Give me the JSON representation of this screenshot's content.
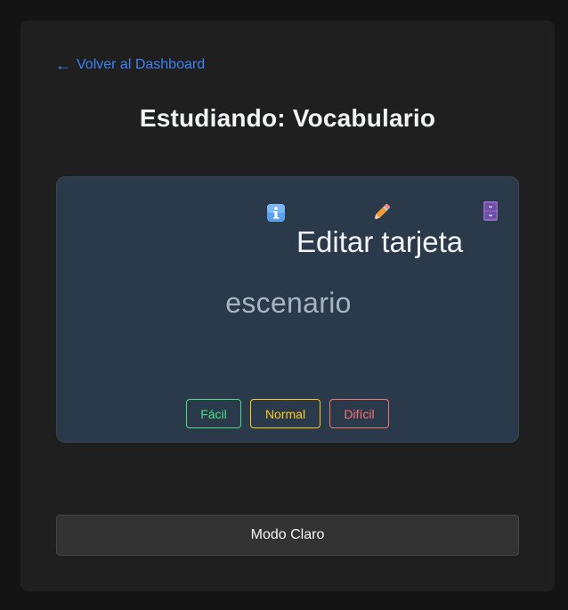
{
  "nav": {
    "back_arrow": "←",
    "back_label": "Volver al Dashboard"
  },
  "header": {
    "title": "Estudiando: Vocabulario"
  },
  "card": {
    "word": "escenario",
    "tooltip": "Editar tarjeta",
    "icons": [
      "info-icon",
      "pencil-icon",
      "file-cabinet-icon"
    ],
    "ratings": {
      "easy": "Fácil",
      "normal": "Normal",
      "hard": "Difícil"
    }
  },
  "footer": {
    "theme_toggle_label": "Modo Claro"
  },
  "colors": {
    "background": "#141414",
    "panel": "#1f1f1f",
    "card": "#2b3a4a",
    "link": "#3b82f6",
    "easy": "#4ade80",
    "normal": "#facc15",
    "hard": "#f87171"
  }
}
